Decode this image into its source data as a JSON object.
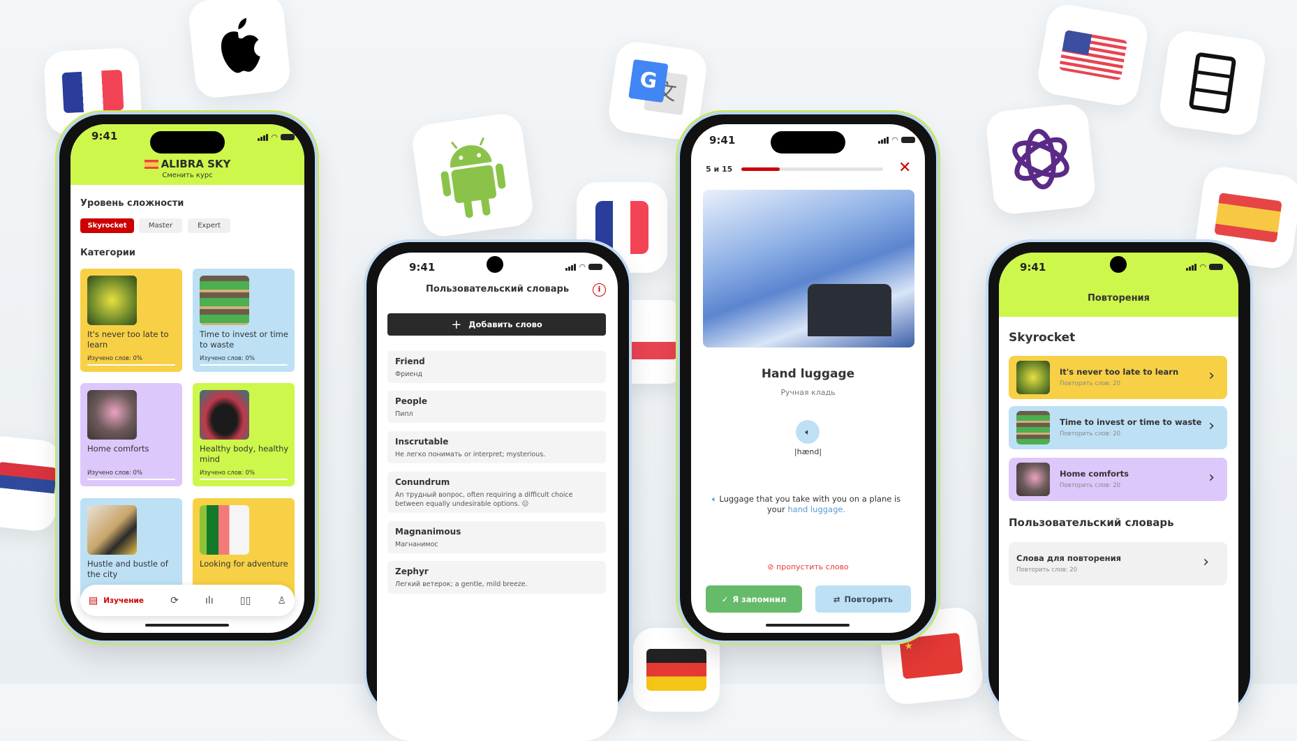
{
  "status": {
    "time": "9:41"
  },
  "background_icons": [
    "france-flag-icon",
    "apple-icon",
    "android-icon",
    "google-translate-icon",
    "france-flag-icon",
    "usa-flag-icon",
    "server-icon",
    "chatgpt-icon",
    "spain-flag-icon",
    "serbia-flag-icon",
    "germany-flag-icon",
    "china-flag-icon"
  ],
  "colors": {
    "accent_red": "#cc0000",
    "lime": "#cdf74a",
    "yellow": "#f7d046",
    "blue": "#bde0f5",
    "purple": "#dcc8fb",
    "green_button": "#66bb6a"
  },
  "learn_screen": {
    "course_title": "ALIBRA SKY",
    "change_course": "Сменить курс",
    "level_heading": "Уровень сложности",
    "levels": [
      {
        "label": "Skyrocket",
        "selected": true
      },
      {
        "label": "Master",
        "selected": false
      },
      {
        "label": "Expert",
        "selected": false
      }
    ],
    "categories_heading": "Категории",
    "categories": [
      {
        "title": "It's never too late to learn",
        "progress": "Изучено слов: 0%"
      },
      {
        "title": "Time to invest or time to waste",
        "progress": "Изучено слов: 0%"
      },
      {
        "title": "Home comforts",
        "progress": "Изучено слов: 0%"
      },
      {
        "title": "Healthy body, healthy mind",
        "progress": "Изучено слов: 0%"
      },
      {
        "title": "Hustle and bustle of the city",
        "progress": ""
      },
      {
        "title": "Looking for adventure",
        "progress": ""
      }
    ],
    "nav": {
      "learn_label": "Изучение",
      "icons": [
        "document-icon",
        "refresh-icon",
        "stats-icon",
        "book-icon",
        "profile-icon"
      ]
    }
  },
  "dictionary_screen": {
    "title": "Пользовательский словарь",
    "add_word": "Добавить слово",
    "words": [
      {
        "word": "Friend",
        "translation": "Фриенд"
      },
      {
        "word": "People",
        "translation": "Пипл"
      },
      {
        "word": "Inscrutable",
        "translation": "Не легко понимать or interpret; mysterious."
      },
      {
        "word": "Conundrum",
        "translation": "An трудный вопрос, often requiring a difficult choice between equally undesirable options. 😑"
      },
      {
        "word": "Magnanimous",
        "translation": "Магнанимос"
      },
      {
        "word": "Zephyr",
        "translation": "Легкий ветерок; a gentle, mild breeze."
      }
    ]
  },
  "flashcard_screen": {
    "counter": "5 и 15",
    "progress_fraction": 0.27,
    "word": "Hand luggage",
    "translation": "Ручная кладь",
    "transcription": "|hænd|",
    "example_prefix": "Luggage that you take with you on a plane is your ",
    "example_highlight": "hand luggage.",
    "skip": "пропустить слово",
    "remembered": "Я запомнил",
    "repeat": "Повторить"
  },
  "review_screen": {
    "title": "Повторения",
    "section": "Skyrocket",
    "items": [
      {
        "title": "It's never too late to learn",
        "sub": "Повторить слов: 20"
      },
      {
        "title": "Time to invest or time to waste",
        "sub": "Повторить слов: 20"
      },
      {
        "title": "Home comforts",
        "sub": "Повторить слов: 20"
      }
    ],
    "dict_section": "Пользовательский словарь",
    "dict_item": {
      "title": "Слова для повторения",
      "sub": "Повторить слов: 20"
    }
  }
}
